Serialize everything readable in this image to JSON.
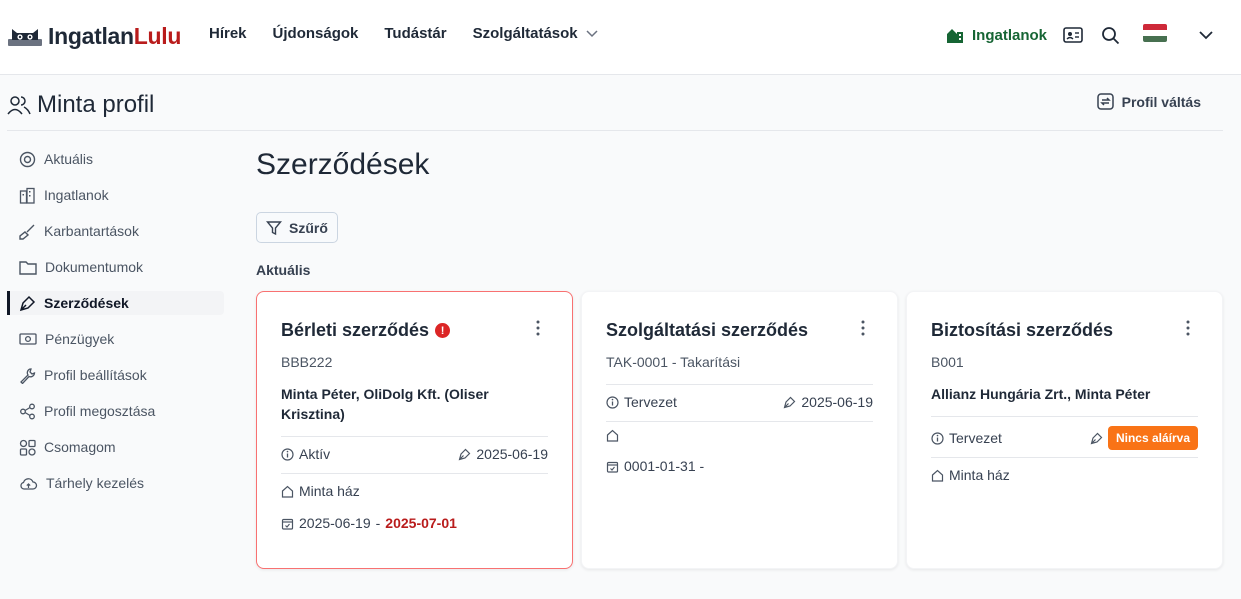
{
  "header": {
    "logo": {
      "part1": "Ingatlan",
      "part2": "Lulu"
    },
    "nav": [
      {
        "label": "Hírek"
      },
      {
        "label": "Újdonságok"
      },
      {
        "label": "Tudástár"
      },
      {
        "label": "Szolgáltatások"
      }
    ],
    "properties_label": "Ingatlanok",
    "flag_colors": [
      "#ce2939",
      "#ffffff",
      "#477050"
    ]
  },
  "profile": {
    "title": "Minta profil",
    "switch_label": "Profil váltás"
  },
  "sidebar": {
    "items": [
      {
        "label": "Aktuális",
        "icon": "target-icon"
      },
      {
        "label": "Ingatlanok",
        "icon": "buildings-icon"
      },
      {
        "label": "Karbantartások",
        "icon": "brush-icon"
      },
      {
        "label": "Dokumentumok",
        "icon": "folder-icon"
      },
      {
        "label": "Szerződések",
        "icon": "pen-icon",
        "active": true
      },
      {
        "label": "Pénzügyek",
        "icon": "money-icon"
      },
      {
        "label": "Profil beállítások",
        "icon": "wrench-icon"
      },
      {
        "label": "Profil megosztása",
        "icon": "share-icon"
      },
      {
        "label": "Csomagom",
        "icon": "package-icon"
      },
      {
        "label": "Tárhely kezelés",
        "icon": "cloud-icon"
      }
    ]
  },
  "main": {
    "title": "Szerződések",
    "filter_label": "Szűrő",
    "section_label": "Aktuális"
  },
  "cards": [
    {
      "title": "Bérleti szerződés",
      "warning_mark": "!",
      "code": "BBB222",
      "parties": "Minta Péter, OliDolg Kft. (Oliser Krisztina)",
      "status": "Aktív",
      "signed_date": "2025-06-19",
      "property": "Minta ház",
      "start_date": "2025-06-19",
      "date_separator": "-",
      "end_date": "2025-07-01"
    },
    {
      "title": "Szolgáltatási szerződés",
      "code": "TAK-0001 - Takarítási",
      "status": "Tervezet",
      "signed_date": "2025-06-19",
      "property": "",
      "date_range": "0001-01-31 -"
    },
    {
      "title": "Biztosítási szerződés",
      "code": "B001",
      "parties": "Allianz Hungária Zrt., Minta Péter",
      "status": "Tervezet",
      "badge": "Nincs aláírva",
      "property": "Minta ház"
    }
  ],
  "colors": {
    "brand_red": "#b91c1c",
    "green": "#166534",
    "alert_border": "#f87171",
    "badge_orange": "#f97316"
  }
}
